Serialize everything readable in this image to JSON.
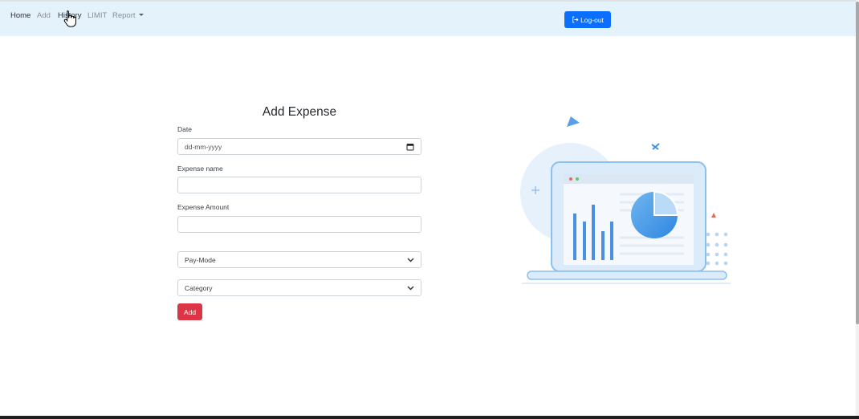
{
  "nav": {
    "items": [
      {
        "label": "Home"
      },
      {
        "label": "Add"
      },
      {
        "label": "History"
      },
      {
        "label": "LIMIT"
      },
      {
        "label": "Report"
      }
    ],
    "logout_label": "Log-out"
  },
  "form": {
    "title": "Add Expense",
    "date_label": "Date",
    "date_placeholder": "dd-mm-yyyy",
    "expense_name_label": "Expense name",
    "expense_name_value": "",
    "expense_amount_label": "Expense Amount",
    "expense_amount_value": "",
    "paymode_selected": "Pay-Mode",
    "category_selected": "Category",
    "add_label": "Add"
  },
  "colors": {
    "navbar_bg": "#e3f2fb",
    "primary": "#0b6efd",
    "danger": "#dc3545"
  },
  "icons": {
    "logout": "logout-icon",
    "calendar": "calendar-icon",
    "dropdown": "chevron-down-icon",
    "cursor": "hand-pointer-icon"
  }
}
